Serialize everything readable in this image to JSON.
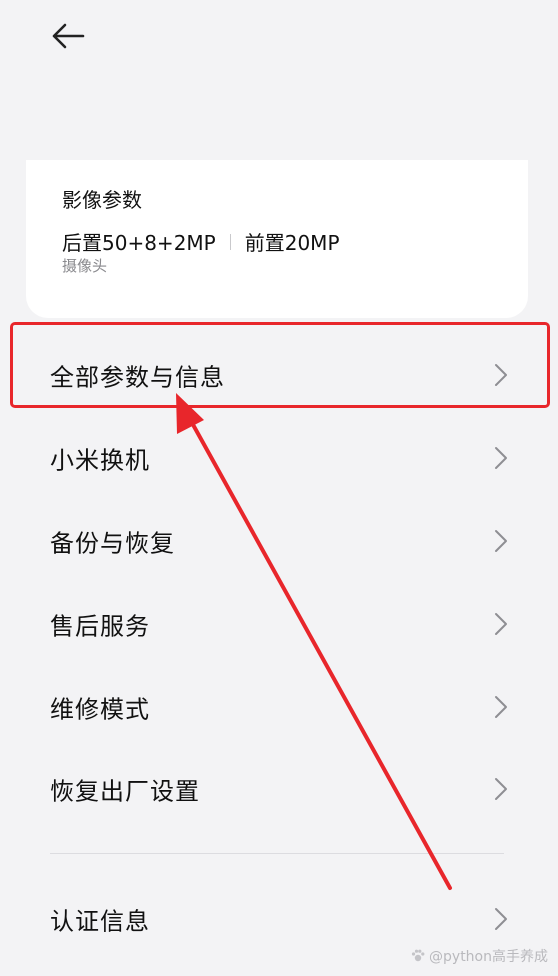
{
  "card": {
    "title": "影像参数",
    "rear_camera": "后置50+8+2MP",
    "front_camera": "前置20MP",
    "subtitle": "摄像头"
  },
  "menu": {
    "items": [
      {
        "label": "全部参数与信息"
      },
      {
        "label": "小米换机"
      },
      {
        "label": "备份与恢复"
      },
      {
        "label": "售后服务"
      },
      {
        "label": "维修模式"
      },
      {
        "label": "恢复出厂设置"
      },
      {
        "label": "认证信息"
      }
    ]
  },
  "watermark": {
    "text": "@python高手养成"
  },
  "colors": {
    "highlight": "#e8262b",
    "background": "#f3f3f5",
    "card": "#ffffff"
  },
  "icons": {
    "back": "arrow-left-icon",
    "chevron": "chevron-right-icon"
  }
}
